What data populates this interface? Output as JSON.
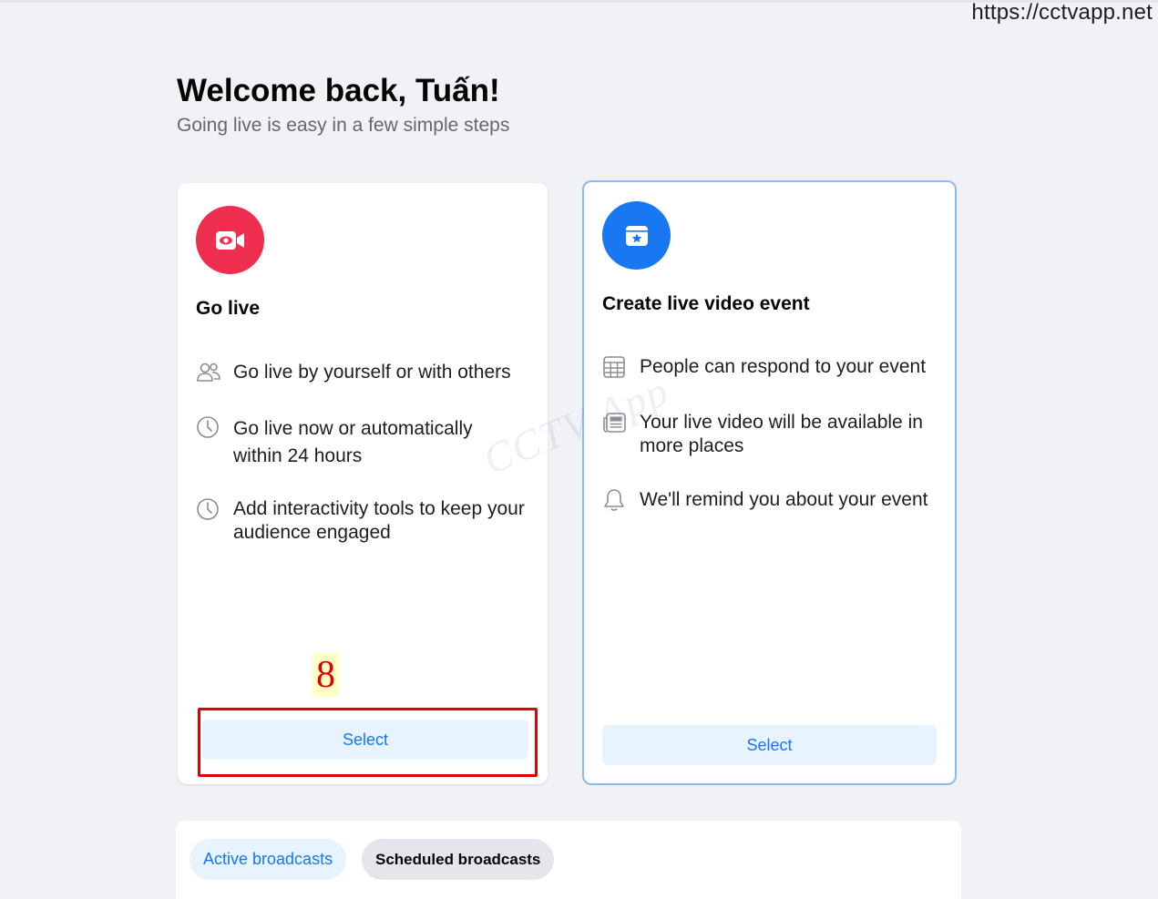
{
  "watermark": {
    "url": "https://cctvapp.net",
    "logo_text": "CCTV App"
  },
  "header": {
    "title": "Welcome back, Tuấn!",
    "subtitle": "Going live is easy in a few simple steps"
  },
  "go_live_card": {
    "icon": "video-camera-icon",
    "icon_color": "#ee2d4f",
    "title": "Go live",
    "features": [
      {
        "icon": "people-icon",
        "text": "Go live by yourself or with others"
      },
      {
        "icon": "clock-icon",
        "text": "Go live now or automatically within 24 hours"
      },
      {
        "icon": "clock-icon",
        "text": "Add interactivity tools to keep your audience engaged"
      }
    ],
    "select_label": "Select"
  },
  "event_card": {
    "icon": "calendar-star-icon",
    "icon_color": "#1877f2",
    "title": "Create live video event",
    "features": [
      {
        "icon": "calendar-grid-icon",
        "text": "People can respond to your event"
      },
      {
        "icon": "news-feed-icon",
        "text": "Your live video will be available in more places"
      },
      {
        "icon": "bell-icon",
        "text": "We'll remind you about your event"
      }
    ],
    "select_label": "Select"
  },
  "annotation": {
    "step_number": "8",
    "color": "#e00000"
  },
  "broadcast_tabs": {
    "active_label": "Active broadcasts",
    "scheduled_label": "Scheduled broadcasts"
  },
  "colors": {
    "accent": "#1877f2",
    "accent_light": "#e7f3ff",
    "background": "#f0f2f5"
  }
}
